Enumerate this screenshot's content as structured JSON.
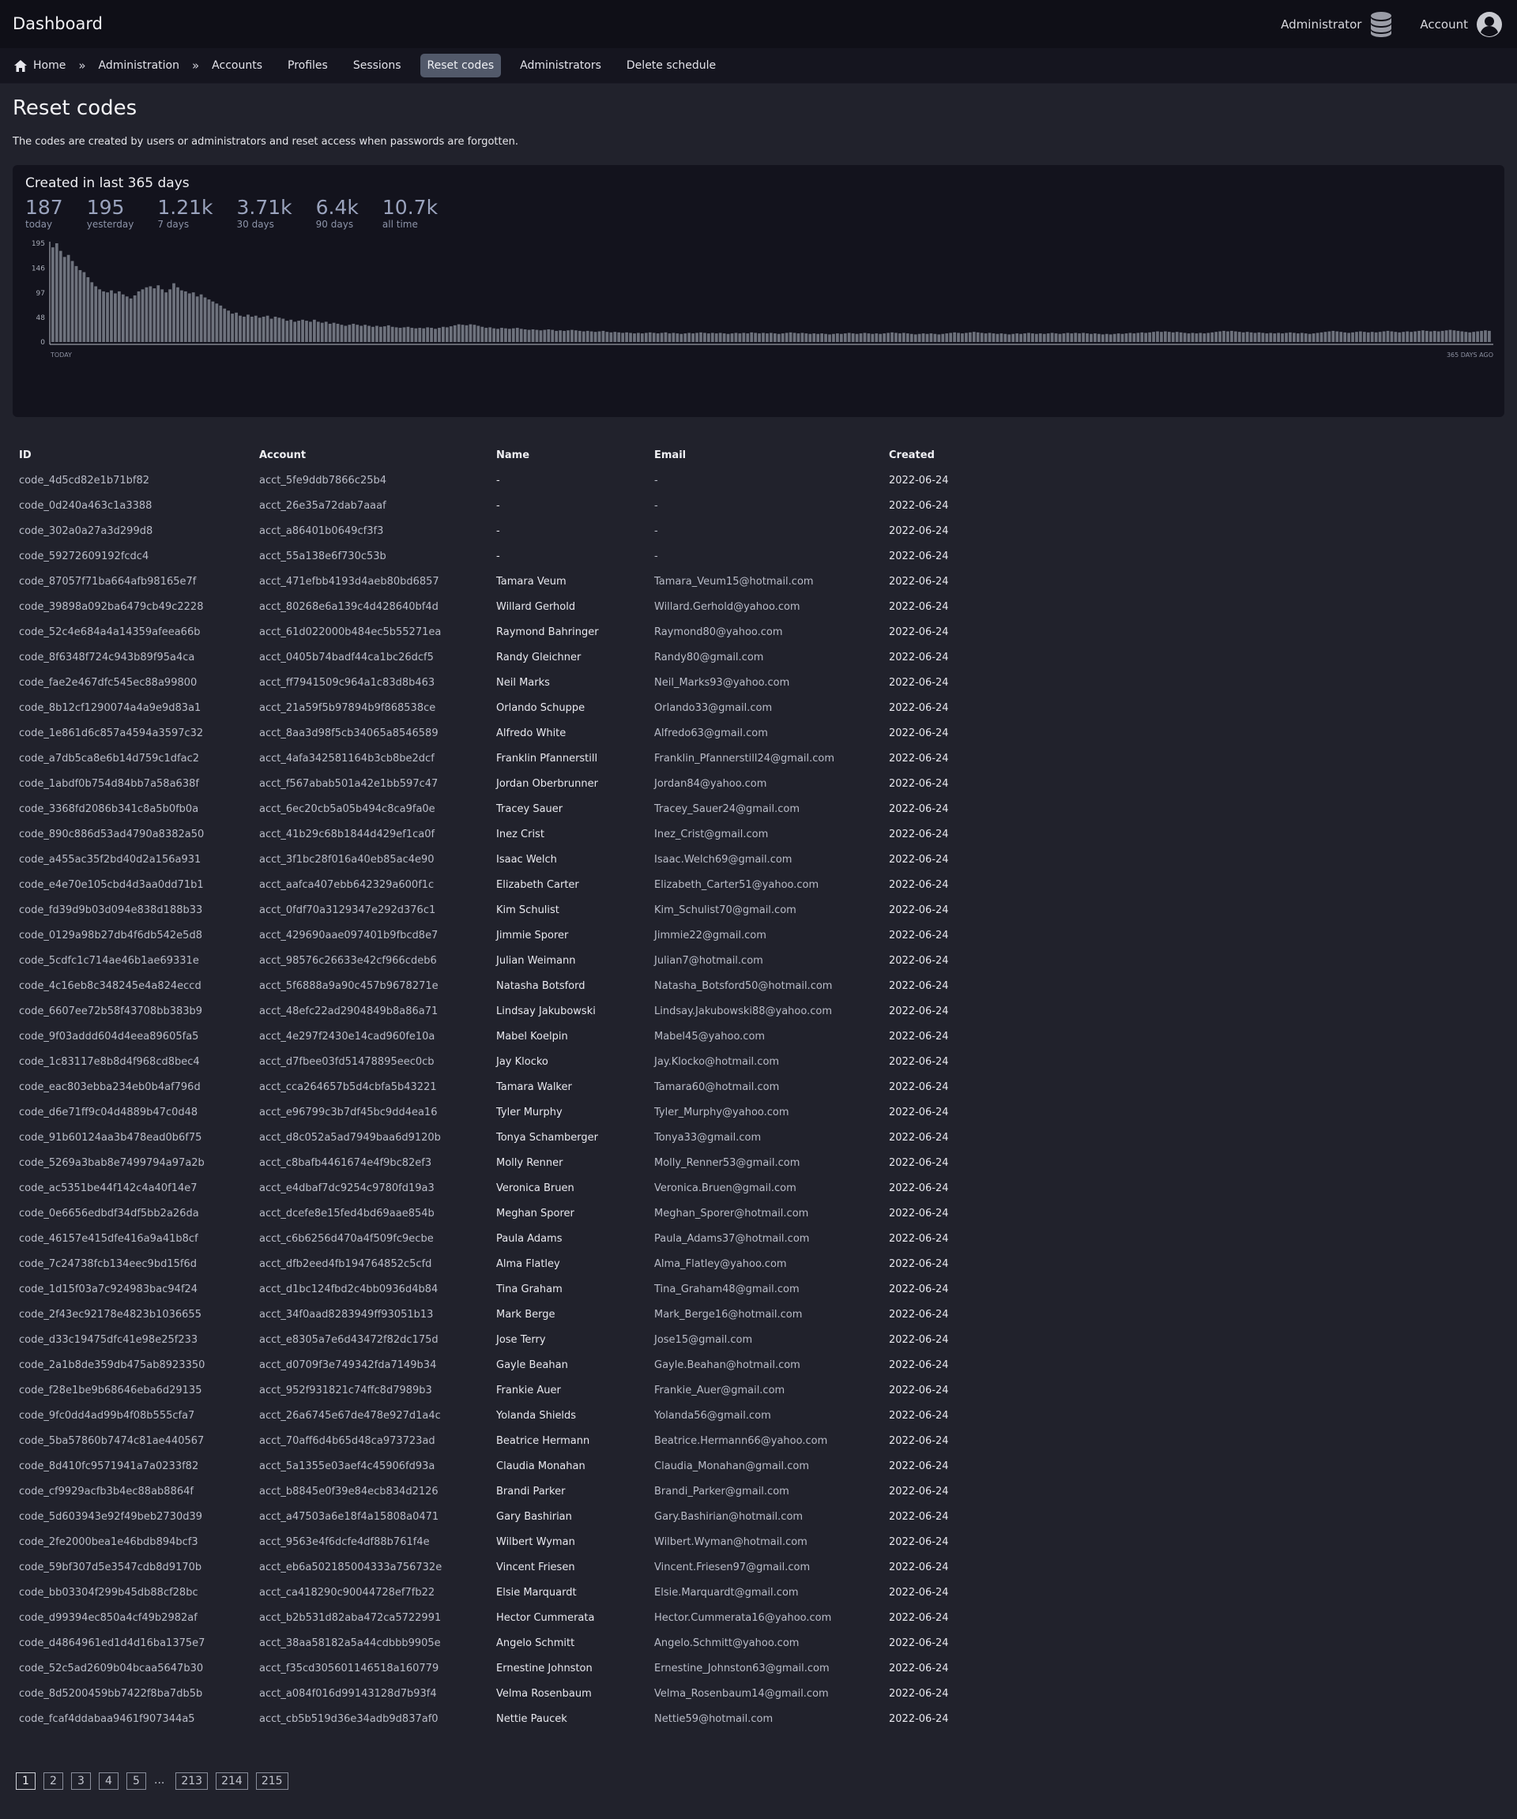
{
  "header": {
    "app_title": "Dashboard",
    "admin_label": "Administrator",
    "account_label": "Account"
  },
  "nav": {
    "home": "Home",
    "administration": "Administration",
    "links": [
      "Accounts",
      "Profiles",
      "Sessions",
      "Reset codes",
      "Administrators",
      "Delete schedule"
    ],
    "active": "Reset codes"
  },
  "page": {
    "title": "Reset codes",
    "intro": "The codes are created by users or administrators and reset access when passwords are forgotten."
  },
  "stats": {
    "title": "Created in last 365 days",
    "items": [
      {
        "value": "187",
        "label": "today"
      },
      {
        "value": "195",
        "label": "yesterday"
      },
      {
        "value": "1.21k",
        "label": "7 days"
      },
      {
        "value": "3.71k",
        "label": "30 days"
      },
      {
        "value": "6.4k",
        "label": "90 days"
      },
      {
        "value": "10.7k",
        "label": "all time"
      }
    ]
  },
  "chart_data": {
    "type": "bar",
    "yticks": [
      195,
      146,
      97,
      48,
      0
    ],
    "ylim": [
      0,
      195
    ],
    "x_left_label": "TODAY",
    "x_right_label": "365 DAYS AGO",
    "values": [
      187,
      195,
      180,
      168,
      172,
      160,
      150,
      142,
      138,
      128,
      118,
      110,
      104,
      100,
      98,
      102,
      96,
      100,
      94,
      90,
      86,
      92,
      100,
      104,
      108,
      110,
      106,
      112,
      104,
      98,
      104,
      116,
      108,
      102,
      100,
      96,
      98,
      90,
      94,
      88,
      84,
      80,
      76,
      72,
      66,
      62,
      56,
      58,
      52,
      50,
      54,
      50,
      52,
      48,
      50,
      52,
      46,
      50,
      48,
      46,
      42,
      44,
      40,
      42,
      44,
      42,
      40,
      44,
      40,
      38,
      40,
      36,
      38,
      36,
      34,
      32,
      34,
      36,
      34,
      32,
      34,
      32,
      30,
      32,
      30,
      31,
      33,
      30,
      29,
      28,
      29,
      30,
      28,
      27,
      28,
      27,
      29,
      28,
      26,
      28,
      30,
      29,
      31,
      33,
      35,
      34,
      33,
      35,
      34,
      32,
      30,
      28,
      29,
      27,
      26,
      28,
      27,
      26,
      27,
      28,
      26,
      25,
      24,
      25,
      24,
      23,
      24,
      25,
      24,
      22,
      23,
      22,
      23,
      24,
      23,
      22,
      21,
      22,
      21,
      20,
      21,
      22,
      20,
      19,
      20,
      19,
      18,
      19,
      18,
      17,
      18,
      17,
      18,
      19,
      18,
      17,
      18,
      19,
      17,
      18,
      17,
      16,
      17,
      18,
      17,
      18,
      19,
      18,
      17,
      18,
      17,
      18,
      17,
      16,
      17,
      18,
      17,
      18,
      17,
      19,
      18,
      17,
      18,
      17,
      18,
      17,
      16,
      17,
      18,
      19,
      18,
      17,
      18,
      17,
      16,
      17,
      16,
      17,
      16,
      15,
      16,
      17,
      16,
      17,
      18,
      17,
      16,
      17,
      18,
      17,
      16,
      17,
      16,
      17,
      18,
      19,
      18,
      17,
      18,
      17,
      16,
      15,
      16,
      17,
      16,
      17,
      16,
      15,
      16,
      17,
      18,
      19,
      18,
      17,
      18,
      19,
      20,
      19,
      18,
      17,
      18,
      17,
      16,
      17,
      16,
      15,
      16,
      17,
      16,
      17,
      18,
      17,
      16,
      17,
      16,
      17,
      18,
      17,
      16,
      17,
      18,
      17,
      18,
      17,
      18,
      17,
      16,
      17,
      16,
      15,
      16,
      15,
      16,
      17,
      16,
      17,
      18,
      17,
      18,
      19,
      18,
      19,
      20,
      21,
      20,
      21,
      20,
      19,
      20,
      19,
      18,
      17,
      18,
      17,
      18,
      17,
      18,
      19,
      20,
      21,
      22,
      21,
      22,
      21,
      20,
      19,
      20,
      19,
      18,
      19,
      18,
      17,
      18,
      17,
      18,
      17,
      18,
      19,
      18,
      17,
      18,
      17,
      16,
      17,
      18,
      19,
      20,
      21,
      22,
      21,
      20,
      19,
      18,
      19,
      20,
      21,
      20,
      19,
      20,
      19,
      20,
      21,
      22,
      21,
      20,
      19,
      20,
      21,
      20,
      21,
      22,
      23,
      22,
      21,
      22,
      21,
      22,
      23,
      24,
      23,
      22,
      21,
      20,
      19,
      20,
      21,
      22,
      23,
      22
    ]
  },
  "table": {
    "headers": [
      "ID",
      "Account",
      "Name",
      "Email",
      "Created"
    ],
    "rows": [
      [
        "code_4d5cd82e1b71bf82",
        "acct_5fe9ddb7866c25b4",
        "-",
        "-",
        "2022-06-24"
      ],
      [
        "code_0d240a463c1a3388",
        "acct_26e35a72dab7aaaf",
        "-",
        "-",
        "2022-06-24"
      ],
      [
        "code_302a0a27a3d299d8",
        "acct_a86401b0649cf3f3",
        "-",
        "-",
        "2022-06-24"
      ],
      [
        "code_59272609192fcdc4",
        "acct_55a138e6f730c53b",
        "-",
        "-",
        "2022-06-24"
      ],
      [
        "code_87057f71ba664afb98165e7f",
        "acct_471efbb4193d4aeb80bd6857",
        "Tamara Veum",
        "Tamara_Veum15@hotmail.com",
        "2022-06-24"
      ],
      [
        "code_39898a092ba6479cb49c2228",
        "acct_80268e6a139c4d428640bf4d",
        "Willard Gerhold",
        "Willard.Gerhold@yahoo.com",
        "2022-06-24"
      ],
      [
        "code_52c4e684a4a14359afeea66b",
        "acct_61d022000b484ec5b55271ea",
        "Raymond Bahringer",
        "Raymond80@yahoo.com",
        "2022-06-24"
      ],
      [
        "code_8f6348f724c943b89f95a4ca",
        "acct_0405b74badf44ca1bc26dcf5",
        "Randy Gleichner",
        "Randy80@gmail.com",
        "2022-06-24"
      ],
      [
        "code_fae2e467dfc545ec88a99800",
        "acct_ff7941509c964a1c83d8b463",
        "Neil Marks",
        "Neil_Marks93@yahoo.com",
        "2022-06-24"
      ],
      [
        "code_8b12cf1290074a4a9e9d83a1",
        "acct_21a59f5b97894b9f868538ce",
        "Orlando Schuppe",
        "Orlando33@gmail.com",
        "2022-06-24"
      ],
      [
        "code_1e861d6c857a4594a3597c32",
        "acct_8aa3d98f5cb34065a8546589",
        "Alfredo White",
        "Alfredo63@gmail.com",
        "2022-06-24"
      ],
      [
        "code_a7db5ca8e6b14d759c1dfac2",
        "acct_4afa342581164b3cb8be2dcf",
        "Franklin Pfannerstill",
        "Franklin_Pfannerstill24@gmail.com",
        "2022-06-24"
      ],
      [
        "code_1abdf0b754d84bb7a58a638f",
        "acct_f567abab501a42e1bb597c47",
        "Jordan Oberbrunner",
        "Jordan84@yahoo.com",
        "2022-06-24"
      ],
      [
        "code_3368fd2086b341c8a5b0fb0a",
        "acct_6ec20cb5a05b494c8ca9fa0e",
        "Tracey Sauer",
        "Tracey_Sauer24@gmail.com",
        "2022-06-24"
      ],
      [
        "code_890c886d53ad4790a8382a50",
        "acct_41b29c68b1844d429ef1ca0f",
        "Inez Crist",
        "Inez_Crist@gmail.com",
        "2022-06-24"
      ],
      [
        "code_a455ac35f2bd40d2a156a931",
        "acct_3f1bc28f016a40eb85ac4e90",
        "Isaac Welch",
        "Isaac.Welch69@gmail.com",
        "2022-06-24"
      ],
      [
        "code_e4e70e105cbd4d3aa0dd71b1",
        "acct_aafca407ebb642329a600f1c",
        "Elizabeth Carter",
        "Elizabeth_Carter51@yahoo.com",
        "2022-06-24"
      ],
      [
        "code_fd39d9b03d094e838d188b33",
        "acct_0fdf70a3129347e292d376c1",
        "Kim Schulist",
        "Kim_Schulist70@gmail.com",
        "2022-06-24"
      ],
      [
        "code_0129a98b27db4f6db542e5d8",
        "acct_429690aae097401b9fbcd8e7",
        "Jimmie Sporer",
        "Jimmie22@gmail.com",
        "2022-06-24"
      ],
      [
        "code_5cdfc1c714ae46b1ae69331e",
        "acct_98576c26633e42cf966cdeb6",
        "Julian Weimann",
        "Julian7@hotmail.com",
        "2022-06-24"
      ],
      [
        "code_4c16eb8c348245e4a824eccd",
        "acct_5f6888a9a90c457b9678271e",
        "Natasha Botsford",
        "Natasha_Botsford50@hotmail.com",
        "2022-06-24"
      ],
      [
        "code_6607ee72b58f43708bb383b9",
        "acct_48efc22ad2904849b8a86a71",
        "Lindsay Jakubowski",
        "Lindsay.Jakubowski88@yahoo.com",
        "2022-06-24"
      ],
      [
        "code_9f03addd604d4eea89605fa5",
        "acct_4e297f2430e14cad960fe10a",
        "Mabel Koelpin",
        "Mabel45@yahoo.com",
        "2022-06-24"
      ],
      [
        "code_1c83117e8b8d4f968cd8bec4",
        "acct_d7fbee03fd51478895eec0cb",
        "Jay Klocko",
        "Jay.Klocko@hotmail.com",
        "2022-06-24"
      ],
      [
        "code_eac803ebba234eb0b4af796d",
        "acct_cca264657b5d4cbfa5b43221",
        "Tamara Walker",
        "Tamara60@hotmail.com",
        "2022-06-24"
      ],
      [
        "code_d6e71ff9c04d4889b47c0d48",
        "acct_e96799c3b7df45bc9dd4ea16",
        "Tyler Murphy",
        "Tyler_Murphy@yahoo.com",
        "2022-06-24"
      ],
      [
        "code_91b60124aa3b478ead0b6f75",
        "acct_d8c052a5ad7949baa6d9120b",
        "Tonya Schamberger",
        "Tonya33@gmail.com",
        "2022-06-24"
      ],
      [
        "code_5269a3bab8e7499794a97a2b",
        "acct_c8bafb4461674e4f9bc82ef3",
        "Molly Renner",
        "Molly_Renner53@gmail.com",
        "2022-06-24"
      ],
      [
        "code_ac5351be44f142c4a40f14e7",
        "acct_e4dbaf7dc9254c9780fd19a3",
        "Veronica Bruen",
        "Veronica.Bruen@gmail.com",
        "2022-06-24"
      ],
      [
        "code_0e6656edbdf34df5bb2a26da",
        "acct_dcefe8e15fed4bd69aae854b",
        "Meghan Sporer",
        "Meghan_Sporer@hotmail.com",
        "2022-06-24"
      ],
      [
        "code_46157e415dfe416a9a41b8cf",
        "acct_c6b6256d470a4f509fc9ecbe",
        "Paula Adams",
        "Paula_Adams37@hotmail.com",
        "2022-06-24"
      ],
      [
        "code_7c24738fcb134eec9bd15f6d",
        "acct_dfb2eed4fb194764852c5cfd",
        "Alma Flatley",
        "Alma_Flatley@yahoo.com",
        "2022-06-24"
      ],
      [
        "code_1d15f03a7c924983bac94f24",
        "acct_d1bc124fbd2c4bb0936d4b84",
        "Tina Graham",
        "Tina_Graham48@gmail.com",
        "2022-06-24"
      ],
      [
        "code_2f43ec92178e4823b1036655",
        "acct_34f0aad8283949ff93051b13",
        "Mark Berge",
        "Mark_Berge16@hotmail.com",
        "2022-06-24"
      ],
      [
        "code_d33c19475dfc41e98e25f233",
        "acct_e8305a7e6d43472f82dc175d",
        "Jose Terry",
        "Jose15@gmail.com",
        "2022-06-24"
      ],
      [
        "code_2a1b8de359db475ab8923350",
        "acct_d0709f3e749342fda7149b34",
        "Gayle Beahan",
        "Gayle.Beahan@hotmail.com",
        "2022-06-24"
      ],
      [
        "code_f28e1be9b68646eba6d29135",
        "acct_952f931821c74ffc8d7989b3",
        "Frankie Auer",
        "Frankie_Auer@gmail.com",
        "2022-06-24"
      ],
      [
        "code_9fc0dd4ad99b4f08b555cfa7",
        "acct_26a6745e67de478e927d1a4c",
        "Yolanda Shields",
        "Yolanda56@gmail.com",
        "2022-06-24"
      ],
      [
        "code_5ba57860b7474c81ae440567",
        "acct_70aff6d4b65d48ca973723ad",
        "Beatrice Hermann",
        "Beatrice.Hermann66@yahoo.com",
        "2022-06-24"
      ],
      [
        "code_8d410fc9571941a7a0233f82",
        "acct_5a1355e03aef4c45906fd93a",
        "Claudia Monahan",
        "Claudia_Monahan@gmail.com",
        "2022-06-24"
      ],
      [
        "code_cf9929acfb3b4ec88ab8864f",
        "acct_b8845e0f39e84ecb834d2126",
        "Brandi Parker",
        "Brandi_Parker@gmail.com",
        "2022-06-24"
      ],
      [
        "code_5d603943e92f49beb2730d39",
        "acct_a47503a6e18f4a15808a0471",
        "Gary Bashirian",
        "Gary.Bashirian@hotmail.com",
        "2022-06-24"
      ],
      [
        "code_2fe2000bea1e46bdb894bcf3",
        "acct_9563e4f6dcfe4df88b761f4e",
        "Wilbert Wyman",
        "Wilbert.Wyman@hotmail.com",
        "2022-06-24"
      ],
      [
        "code_59bf307d5e3547cdb8d9170b",
        "acct_eb6a502185004333a756732e",
        "Vincent Friesen",
        "Vincent.Friesen97@gmail.com",
        "2022-06-24"
      ],
      [
        "code_bb03304f299b45db88cf28bc",
        "acct_ca418290c90044728ef7fb22",
        "Elsie Marquardt",
        "Elsie.Marquardt@gmail.com",
        "2022-06-24"
      ],
      [
        "code_d99394ec850a4cf49b2982af",
        "acct_b2b531d82aba472ca5722991",
        "Hector Cummerata",
        "Hector.Cummerata16@yahoo.com",
        "2022-06-24"
      ],
      [
        "code_d4864961ed1d4d16ba1375e7",
        "acct_38aa58182a5a44cdbbb9905e",
        "Angelo Schmitt",
        "Angelo.Schmitt@yahoo.com",
        "2022-06-24"
      ],
      [
        "code_52c5ad2609b04bcaa5647b30",
        "acct_f35cd305601146518a160779",
        "Ernestine Johnston",
        "Ernestine_Johnston63@gmail.com",
        "2022-06-24"
      ],
      [
        "code_8d5200459bb7422f8ba7db5b",
        "acct_a084f016d99143128d7b93f4",
        "Velma Rosenbaum",
        "Velma_Rosenbaum14@gmail.com",
        "2022-06-24"
      ],
      [
        "code_fcaf4ddabaa9461f907344a5",
        "acct_cb5b519d36e34adb9d837af0",
        "Nettie Paucek",
        "Nettie59@hotmail.com",
        "2022-06-24"
      ]
    ]
  },
  "pagination": {
    "pages": [
      "1",
      "2",
      "3",
      "4",
      "5"
    ],
    "ellipsis": "...",
    "last_pages": [
      "213",
      "214",
      "215"
    ],
    "current": "1"
  },
  "icons": {
    "database": "database-icon",
    "account": "user-circle-icon",
    "home": "home-icon"
  }
}
